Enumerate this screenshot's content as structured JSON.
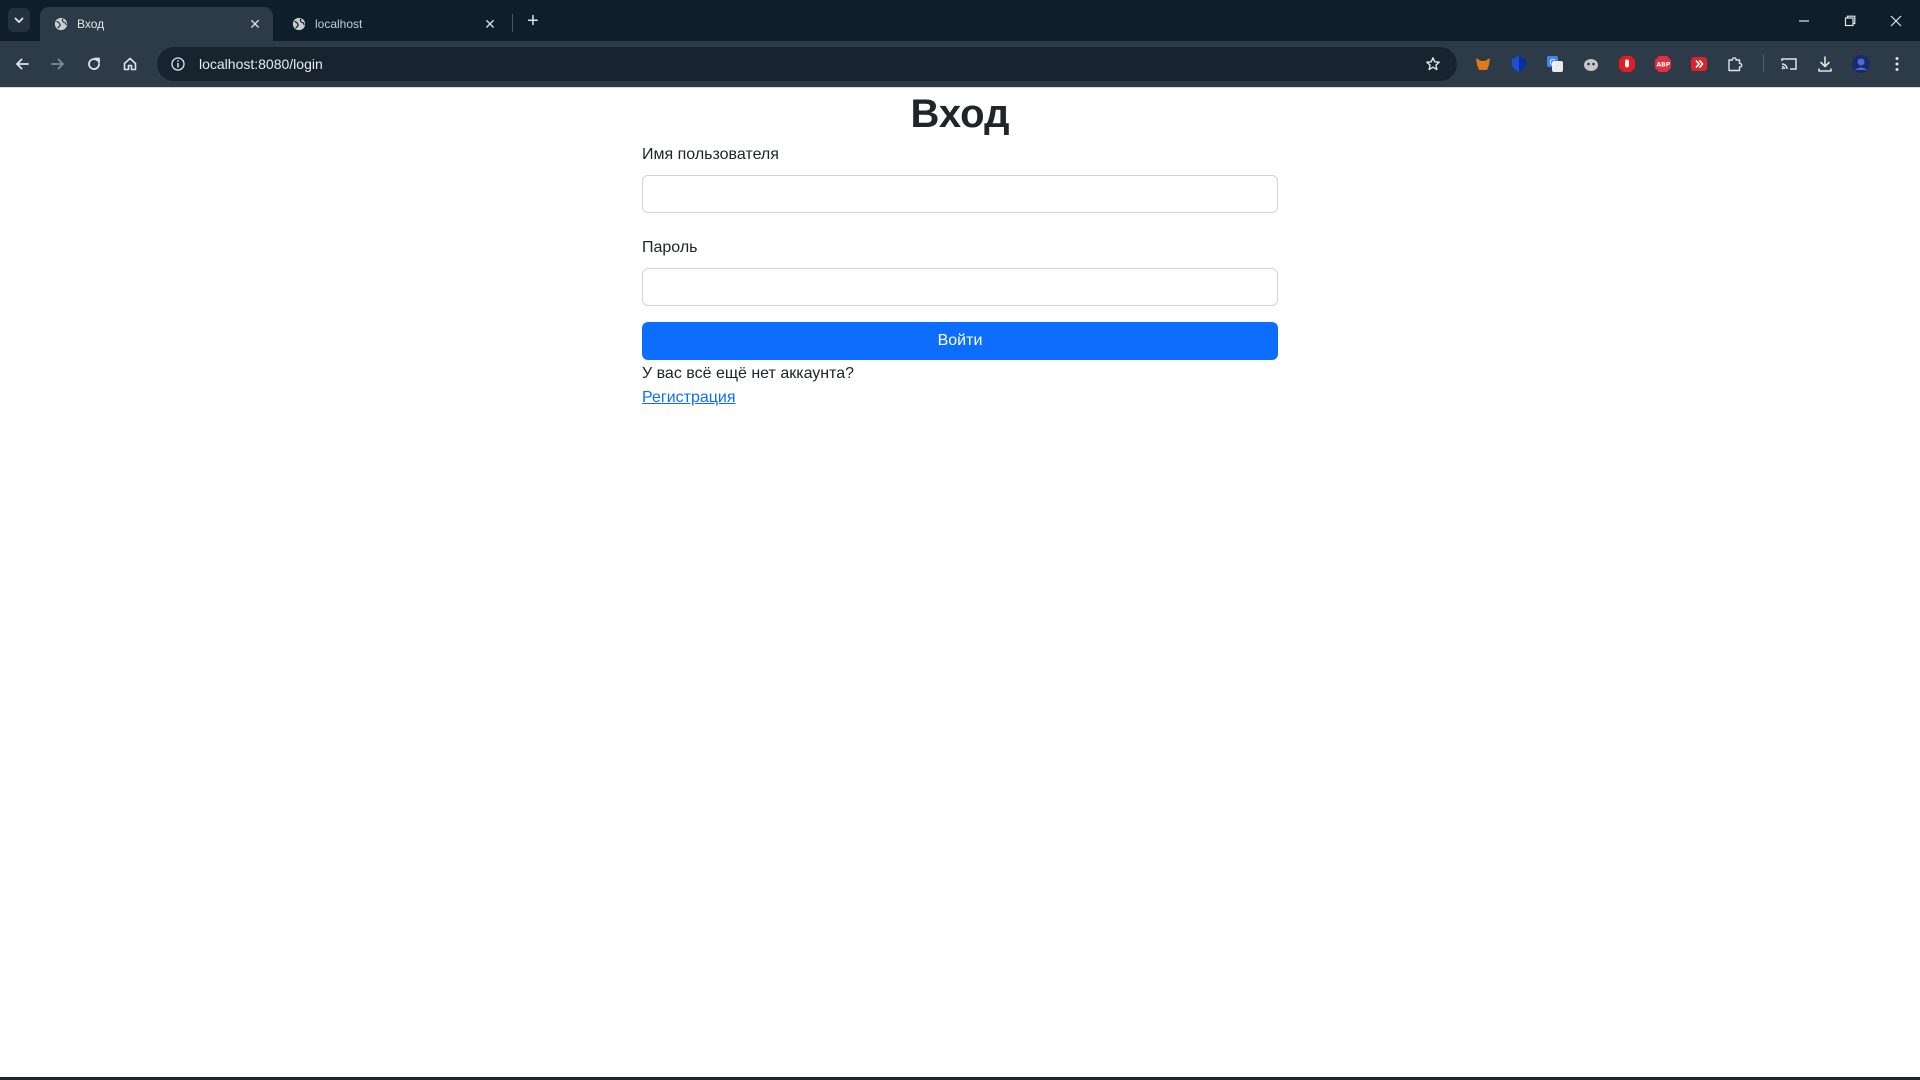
{
  "browser": {
    "tabs": [
      {
        "title": "Вход",
        "active": true
      },
      {
        "title": "localhost",
        "active": false
      }
    ],
    "url": "localhost:8080/login",
    "extensions": [
      "metamask-icon",
      "shield-icon",
      "translate-icon",
      "ghost-icon",
      "stop-hand-icon",
      "adblock-icon",
      "video-icon",
      "puzzle-icon"
    ],
    "colors": {
      "tabstrip": "#0f1e2b",
      "toolbar": "#2d3b48",
      "omnibox": "#17242f"
    }
  },
  "page": {
    "heading": "Вход",
    "username_label": "Имя пользователя",
    "username_value": "",
    "password_label": "Пароль",
    "password_value": "",
    "submit_label": "Войти",
    "no_account_text": "У вас всё ещё нет аккаунта?",
    "register_link": "Регистрация",
    "colors": {
      "primary": "#0d6efd",
      "text": "#212529",
      "border": "#ced4da"
    }
  }
}
